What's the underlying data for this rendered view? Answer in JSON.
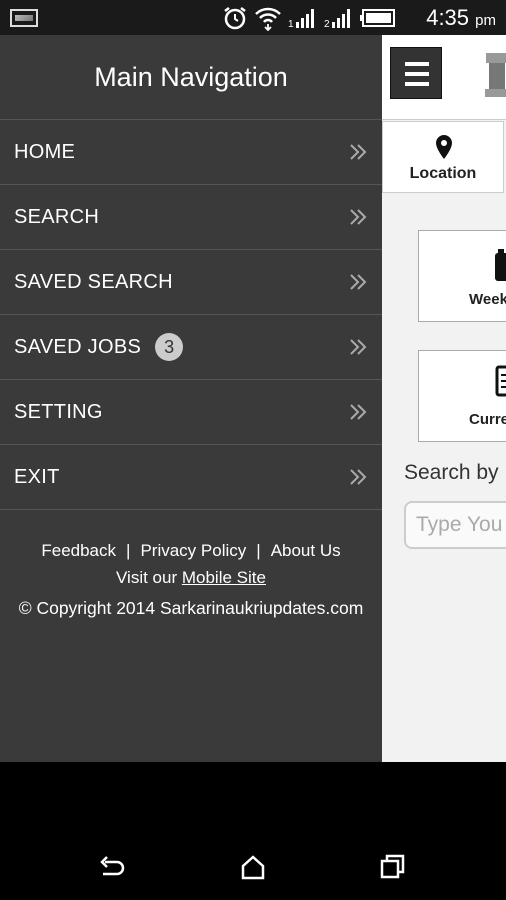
{
  "status_bar": {
    "time": "4:35",
    "ampm": "pm",
    "icons": [
      "gallery-icon",
      "alarm-icon",
      "wifi-icon",
      "signal-1-icon",
      "signal-2-icon",
      "battery-icon"
    ]
  },
  "drawer": {
    "title": "Main Navigation",
    "items": [
      {
        "label": "HOME"
      },
      {
        "label": "SEARCH"
      },
      {
        "label": "SAVED SEARCH"
      },
      {
        "label": "SAVED JOBS",
        "badge": "3"
      },
      {
        "label": "SETTING"
      },
      {
        "label": "EXIT"
      }
    ],
    "footer": {
      "links": [
        "Feedback",
        "Privacy Policy",
        "About Us"
      ],
      "visit_prefix": "Visit our",
      "visit_link": "Mobile Site",
      "copyright": "© Copyright 2014 Sarkarinaukriupdates.com"
    }
  },
  "main": {
    "location_label": "Location",
    "cards": [
      "Week",
      "Curre"
    ],
    "search_label": "Search by",
    "search_placeholder": "Type You"
  },
  "system_nav": [
    "back-icon",
    "home-icon",
    "recents-icon"
  ]
}
